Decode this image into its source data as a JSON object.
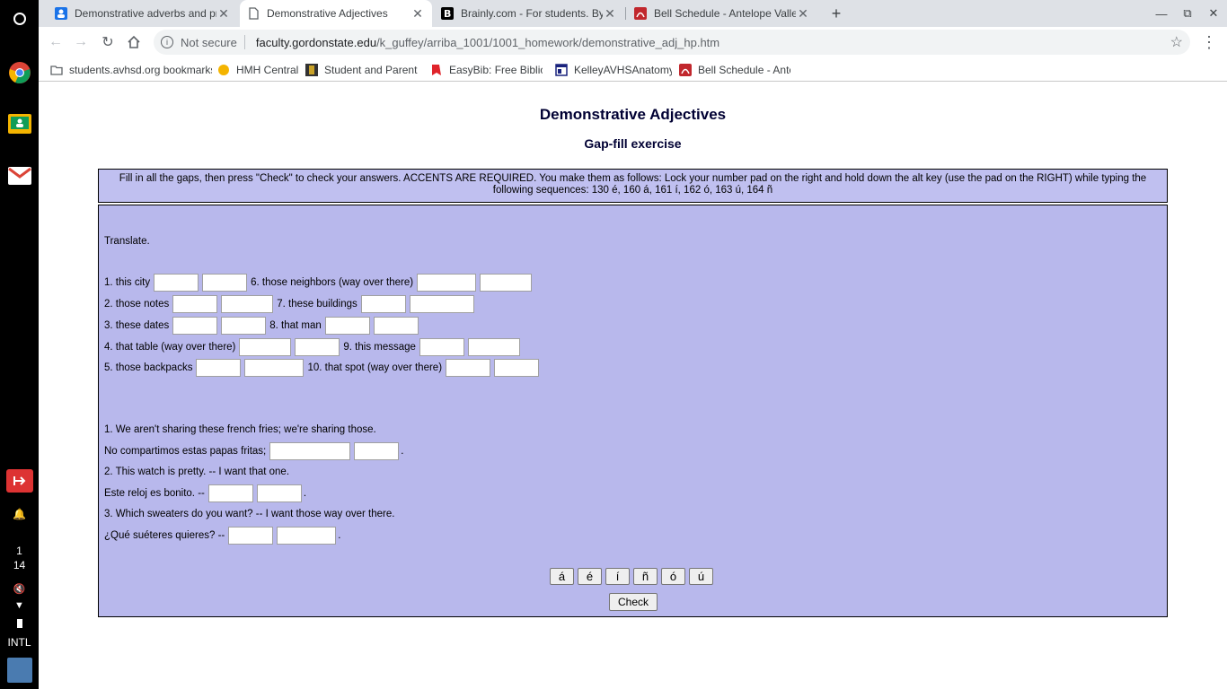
{
  "shelf": {
    "time_hour": "1",
    "time_min": "14",
    "ime": "INTL"
  },
  "tabs": [
    {
      "title": "Demonstrative adverbs and pronouns"
    },
    {
      "title": "Demonstrative Adjectives"
    },
    {
      "title": "Brainly.com - For students. By students."
    },
    {
      "title": "Bell Schedule - Antelope Valley High"
    }
  ],
  "omnibox": {
    "security": "Not secure",
    "host": "faculty.gordonstate.edu",
    "path": "/k_guffey/arriba_1001/1001_homework/demonstrative_adj_hp.htm"
  },
  "bookmarks": [
    "students.avhsd.org bookmarks",
    "HMH Central",
    "Student and Parent",
    "EasyBib: Free Bibliog",
    "KelleyAVHSAnatomy",
    "Bell Schedule - Antel"
  ],
  "page": {
    "title": "Demonstrative Adjectives",
    "subtitle": "Gap-fill exercise",
    "instructions": "Fill in all the gaps, then press \"Check\" to check your answers. ACCENTS ARE REQUIRED. You make them as follows: Lock your number pad on the right and hold down the alt key (use the pad on the RIGHT) while typing the following sequences: 130 é, 160 á, 161 í, 162 ó, 163 ú, 164 ñ",
    "translate_label": "Translate.",
    "rows": [
      {
        "a": "1. this city",
        "b": "6. those neighbors (way over there)"
      },
      {
        "a": "2. those notes",
        "b": "7. these buildings"
      },
      {
        "a": "3. these dates",
        "b": "8. that man"
      },
      {
        "a": "4. that table (way over there)",
        "b": "9. this message"
      },
      {
        "a": "5. those backpacks",
        "b": "10. that spot (way over there)"
      }
    ],
    "sentences": [
      {
        "en": "1. We aren't sharing these french fries; we're sharing those.",
        "es": "No compartimos estas papas fritas;"
      },
      {
        "en": "2. This watch is pretty. -- I want that one.",
        "es": "Este reloj es bonito. --"
      },
      {
        "en": "3. Which sweaters do you want? -- I want those way over there.",
        "es": "¿Qué suéteres quieres? --"
      }
    ],
    "period": ".",
    "accent_buttons": [
      "á",
      "é",
      "í",
      "ñ",
      "ó",
      "ú"
    ],
    "check_label": "Check"
  }
}
